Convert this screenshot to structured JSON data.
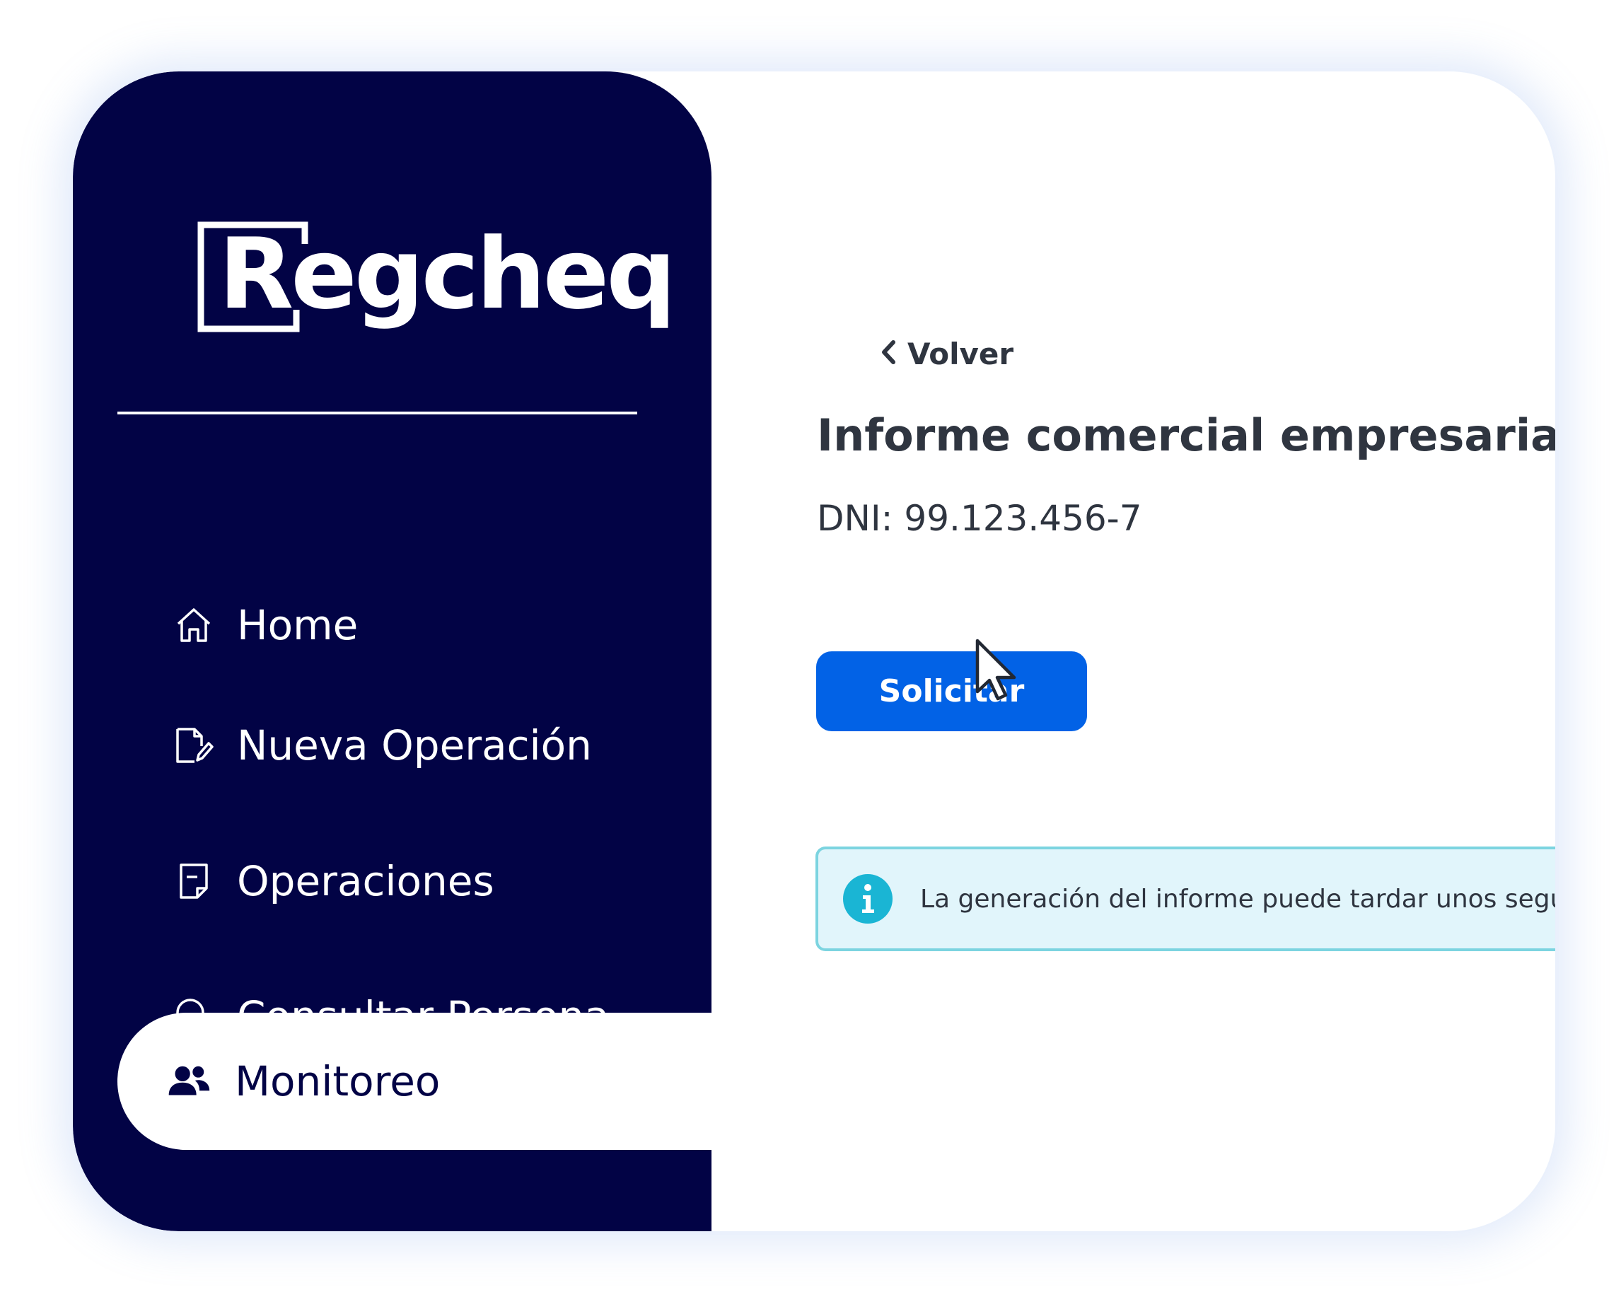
{
  "app": {
    "name": "Regcheq"
  },
  "sidebar": {
    "items": [
      {
        "label": "Home",
        "icon": "home-icon",
        "active": false
      },
      {
        "label": "Nueva Operación",
        "icon": "new-document-icon",
        "active": false
      },
      {
        "label": "Operaciones",
        "icon": "document-icon",
        "active": false
      },
      {
        "label": "Consultar Persona",
        "icon": "search-icon",
        "active": false
      },
      {
        "label": "Monitoreo",
        "icon": "users-icon",
        "active": true
      }
    ]
  },
  "main": {
    "back_label": "Volver",
    "title": "Informe comercial empresarial",
    "dni_label": "DNI:",
    "dni_value": "99.123.456-7",
    "submit_label": "Solicitar",
    "alert_text": "La generación del informe puede tardar unos segundos"
  },
  "colors": {
    "sidebar_bg": "#020345",
    "primary_button": "#0262e6",
    "alert_bg": "#e1f5fb",
    "alert_border": "#7cd4e0",
    "info_icon": "#1ab5d4",
    "text": "#2f3540"
  }
}
